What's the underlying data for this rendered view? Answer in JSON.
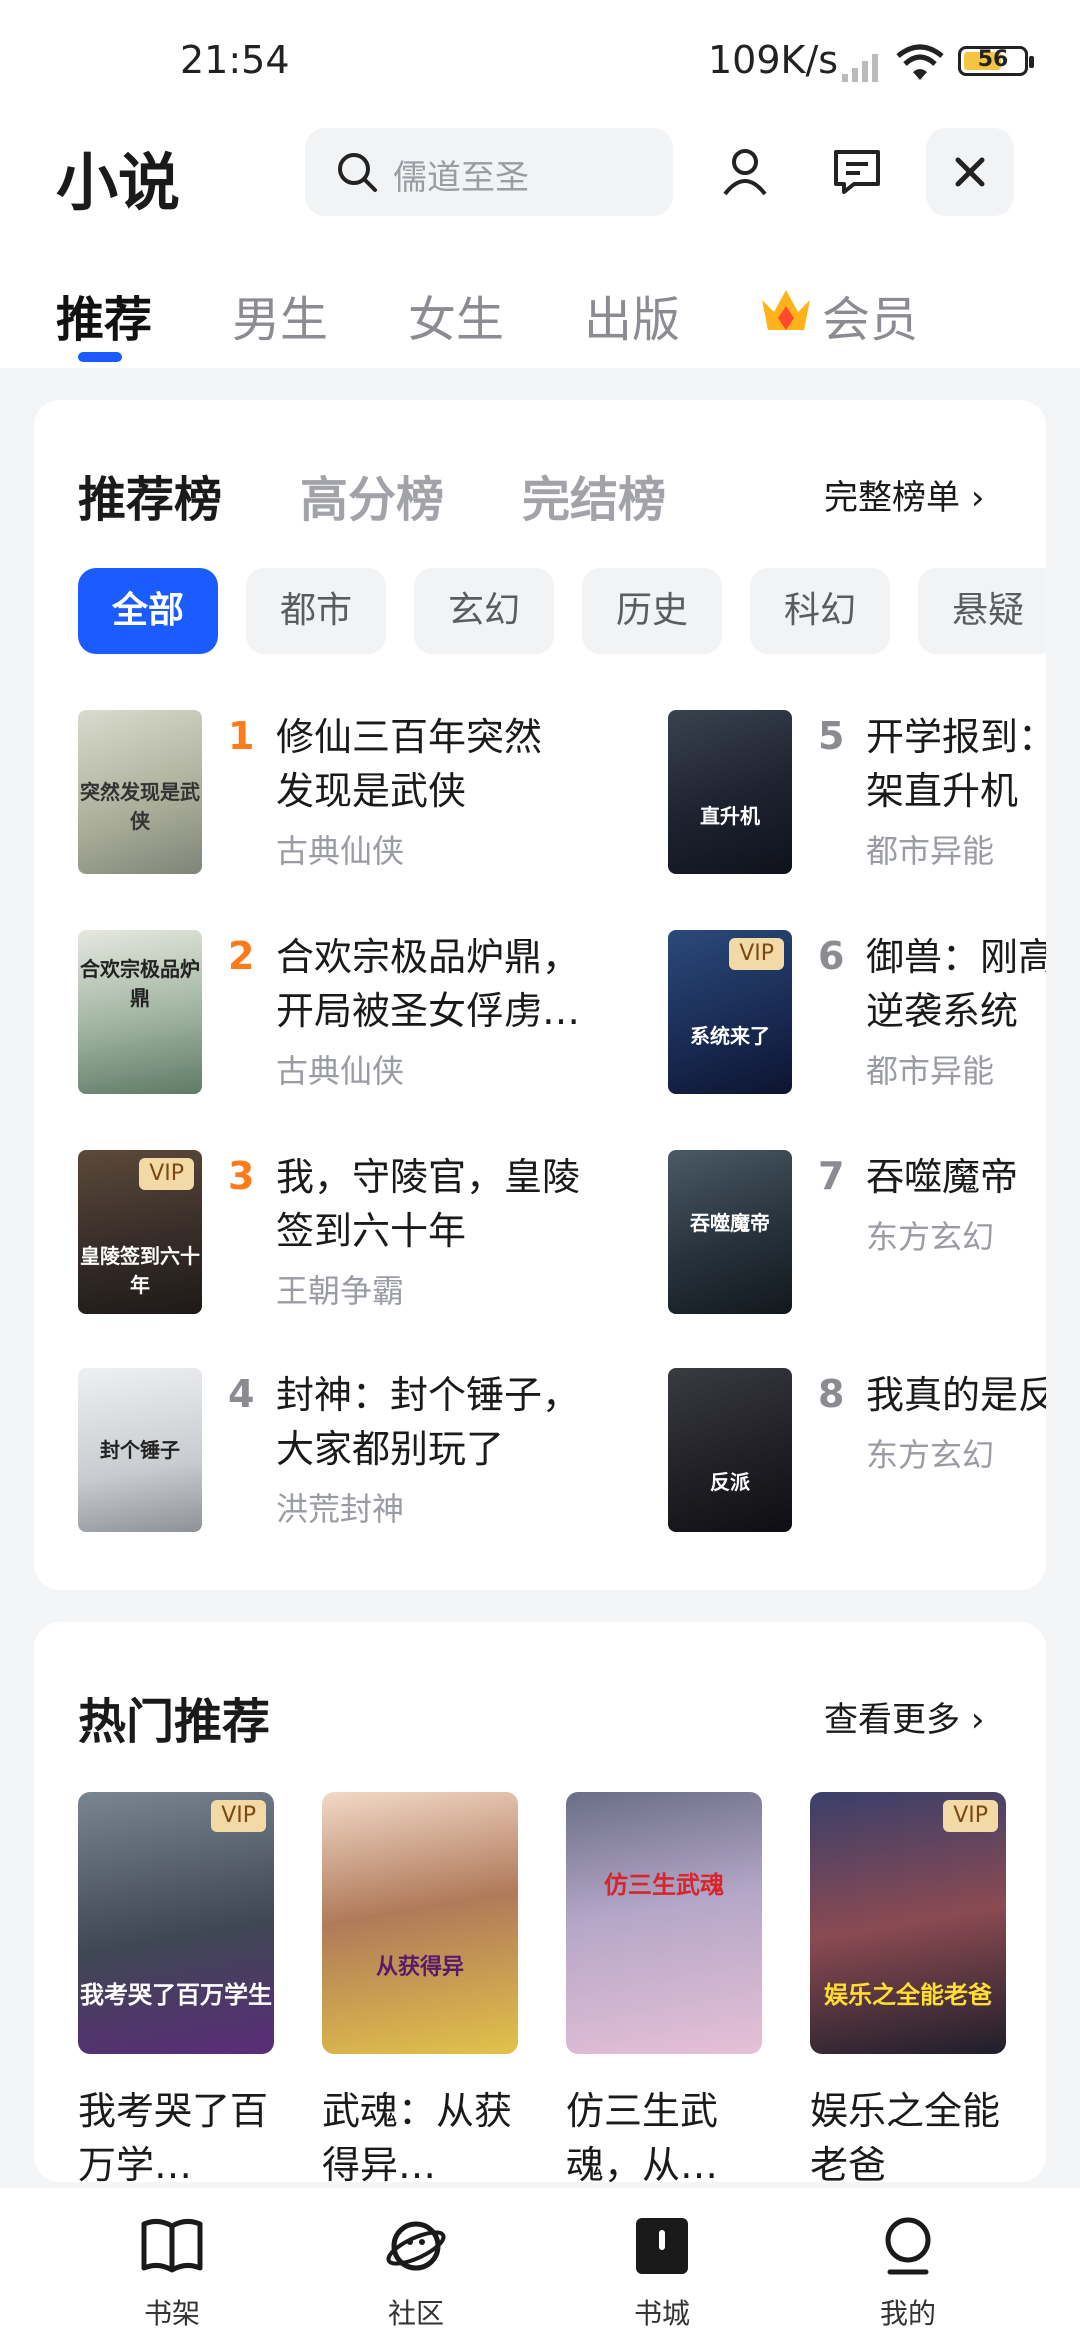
{
  "status": {
    "time": "21:54",
    "network_speed": "109K/s",
    "battery": "56"
  },
  "header": {
    "title": "小说",
    "search_placeholder": "儒道至圣"
  },
  "tabs": [
    {
      "label": "推荐",
      "active": true
    },
    {
      "label": "男生",
      "active": false
    },
    {
      "label": "女生",
      "active": false
    },
    {
      "label": "出版",
      "active": false
    },
    {
      "label": "会员",
      "active": false
    }
  ],
  "ranking": {
    "tabs": [
      "推荐榜",
      "高分榜",
      "完结榜"
    ],
    "full_list_label": "完整榜单",
    "chips": [
      "全部",
      "都市",
      "玄幻",
      "历史",
      "科幻",
      "悬疑"
    ],
    "items": [
      {
        "rank": "1",
        "title": "修仙三百年突然发现是武侠",
        "category": "古典仙侠",
        "vip": false,
        "cover_text": "突然发现是武侠"
      },
      {
        "rank": "2",
        "title": "合欢宗极品炉鼎，开局被圣女俘虏…",
        "category": "古典仙侠",
        "vip": false,
        "cover_text": "合欢宗极品炉鼎"
      },
      {
        "rank": "3",
        "title": "我，守陵官，皇陵签到六十年",
        "category": "王朝争霸",
        "vip": true,
        "cover_text": "皇陵签到六十年"
      },
      {
        "rank": "4",
        "title": "封神：封个锤子，大家都别玩了",
        "category": "洪荒封神",
        "vip": false,
        "cover_text": "封个锤子"
      },
      {
        "rank": "5",
        "title": "开学报到：一架直升机",
        "category": "都市异能",
        "vip": false,
        "cover_text": "直升机"
      },
      {
        "rank": "6",
        "title": "御兽：刚高年逆袭系统",
        "category": "都市异能",
        "vip": true,
        "cover_text": "系统来了"
      },
      {
        "rank": "7",
        "title": "吞噬魔帝",
        "category": "东方玄幻",
        "vip": false,
        "cover_text": "吞噬魔帝"
      },
      {
        "rank": "8",
        "title": "我真的是反派",
        "category": "东方玄幻",
        "vip": false,
        "cover_text": "反派"
      }
    ]
  },
  "hot": {
    "title": "热门推荐",
    "more_label": "查看更多",
    "items": [
      {
        "title": "我考哭了百万学…",
        "vip": true,
        "cover_text": "我考哭了百万学生"
      },
      {
        "title": "武魂：从获得异…",
        "vip": false,
        "cover_text": "从获得异"
      },
      {
        "title": "仿三生武魂，从…",
        "vip": false,
        "cover_text": "仿三生武魂"
      },
      {
        "title": "娱乐之全能老爸",
        "vip": true,
        "cover_text": "娱乐之全能老爸"
      }
    ]
  },
  "vip_label": "VIP",
  "bottom_nav": [
    {
      "label": "书架",
      "icon": "book-icon"
    },
    {
      "label": "社区",
      "icon": "planet-icon"
    },
    {
      "label": "书城",
      "icon": "store-icon"
    },
    {
      "label": "我的",
      "icon": "profile-icon"
    }
  ],
  "colors": {
    "accent": "#1a5cff",
    "rank_highlight": "#ff7a1a",
    "vip_bg": "#f3d9a6"
  }
}
